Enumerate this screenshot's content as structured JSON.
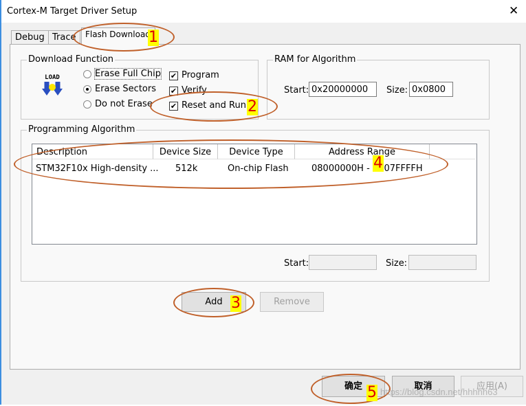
{
  "window": {
    "title": "Cortex-M Target Driver Setup",
    "close_icon": "close-icon"
  },
  "tabs": [
    {
      "label": "Debug"
    },
    {
      "label": "Trace"
    },
    {
      "label": "Flash Download"
    }
  ],
  "download_function": {
    "label": "Download Function",
    "icon": "LOAD",
    "erase_options": [
      {
        "label": "Erase Full Chip",
        "selected": false
      },
      {
        "label": "Erase Sectors",
        "selected": true
      },
      {
        "label": "Do not Erase",
        "selected": false
      }
    ],
    "checks": [
      {
        "label": "Program",
        "checked": true
      },
      {
        "label": "Verify",
        "checked": true
      },
      {
        "label": "Reset and Run",
        "checked": true
      }
    ]
  },
  "ram": {
    "label": "RAM for Algorithm",
    "start_label": "Start:",
    "start": "0x20000000",
    "size_label": "Size:",
    "size": "0x0800"
  },
  "algorithm": {
    "label": "Programming Algorithm",
    "columns": [
      "Description",
      "Device Size",
      "Device Type",
      "Address Range"
    ],
    "rows": [
      [
        "STM32F10x High-density ...",
        "512k",
        "On-chip Flash",
        "08000000H - 0807FFFFH"
      ]
    ],
    "start_label": "Start:",
    "start": "",
    "size_label": "Size:",
    "size": ""
  },
  "buttons": {
    "add": "Add",
    "remove": "Remove",
    "ok": "确定",
    "cancel": "取消",
    "apply": "应用(A)"
  },
  "annotations": [
    "1",
    "2",
    "3",
    "4",
    "5"
  ],
  "watermark": "https://blog.csdn.net/hhhhh63",
  "colors": {
    "annotation": "#c0602a",
    "highlight": "#ffff00"
  }
}
